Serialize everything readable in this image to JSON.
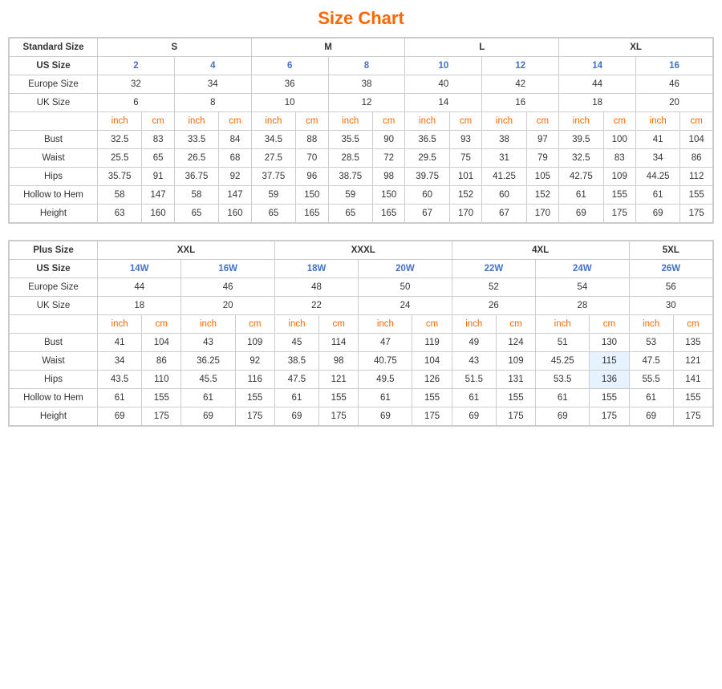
{
  "title": "Size Chart",
  "standard_table": {
    "main_header": "Standard Size",
    "size_groups": [
      "S",
      "M",
      "L",
      "XL"
    ],
    "us_sizes": [
      "2",
      "4",
      "6",
      "8",
      "10",
      "12",
      "14",
      "16"
    ],
    "europe_sizes": [
      "32",
      "34",
      "36",
      "38",
      "40",
      "42",
      "44",
      "46"
    ],
    "uk_sizes": [
      "6",
      "8",
      "10",
      "12",
      "14",
      "16",
      "18",
      "20"
    ],
    "inch_cm_header": [
      "inch",
      "cm",
      "inch",
      "cm",
      "inch",
      "cm",
      "inch",
      "cm",
      "inch",
      "cm",
      "inch",
      "cm",
      "inch",
      "cm",
      "inch",
      "cm"
    ],
    "bust": [
      "32.5",
      "83",
      "33.5",
      "84",
      "34.5",
      "88",
      "35.5",
      "90",
      "36.5",
      "93",
      "38",
      "97",
      "39.5",
      "100",
      "41",
      "104"
    ],
    "waist": [
      "25.5",
      "65",
      "26.5",
      "68",
      "27.5",
      "70",
      "28.5",
      "72",
      "29.5",
      "75",
      "31",
      "79",
      "32.5",
      "83",
      "34",
      "86"
    ],
    "hips": [
      "35.75",
      "91",
      "36.75",
      "92",
      "37.75",
      "96",
      "38.75",
      "98",
      "39.75",
      "101",
      "41.25",
      "105",
      "42.75",
      "109",
      "44.25",
      "112"
    ],
    "hollow_to_hem": [
      "58",
      "147",
      "58",
      "147",
      "59",
      "150",
      "59",
      "150",
      "60",
      "152",
      "60",
      "152",
      "61",
      "155",
      "61",
      "155"
    ],
    "height": [
      "63",
      "160",
      "65",
      "160",
      "65",
      "165",
      "65",
      "165",
      "67",
      "170",
      "67",
      "170",
      "69",
      "175",
      "69",
      "175"
    ]
  },
  "plus_table": {
    "main_header": "Plus Size",
    "size_groups": [
      "XXL",
      "XXXL",
      "4XL",
      "5XL"
    ],
    "us_sizes": [
      "14W",
      "16W",
      "18W",
      "20W",
      "22W",
      "24W",
      "26W"
    ],
    "europe_sizes": [
      "44",
      "46",
      "48",
      "50",
      "52",
      "54",
      "56"
    ],
    "uk_sizes": [
      "18",
      "20",
      "22",
      "24",
      "26",
      "28",
      "30"
    ],
    "inch_cm_header": [
      "inch",
      "cm",
      "inch",
      "cm",
      "inch",
      "cm",
      "inch",
      "cm",
      "inch",
      "cm",
      "inch",
      "cm",
      "inch",
      "cm"
    ],
    "bust": [
      "41",
      "104",
      "43",
      "109",
      "45",
      "114",
      "47",
      "119",
      "49",
      "124",
      "51",
      "130",
      "53",
      "135"
    ],
    "waist": [
      "34",
      "86",
      "36.25",
      "92",
      "38.5",
      "98",
      "40.75",
      "104",
      "43",
      "109",
      "45.25",
      "115",
      "47.5",
      "121"
    ],
    "hips": [
      "43.5",
      "110",
      "45.5",
      "116",
      "47.5",
      "121",
      "49.5",
      "126",
      "51.5",
      "131",
      "53.5",
      "136",
      "55.5",
      "141"
    ],
    "hollow_to_hem": [
      "61",
      "155",
      "61",
      "155",
      "61",
      "155",
      "61",
      "155",
      "61",
      "155",
      "61",
      "155",
      "61",
      "155"
    ],
    "height": [
      "69",
      "175",
      "69",
      "175",
      "69",
      "175",
      "69",
      "175",
      "69",
      "175",
      "69",
      "175",
      "69",
      "175"
    ]
  },
  "labels": {
    "us_size": "US Size",
    "europe_size": "Europe Size",
    "uk_size": "UK Size",
    "bust": "Bust",
    "waist": "Waist",
    "hips": "Hips",
    "hollow_to_hem": "Hollow to Hem",
    "height": "Height"
  }
}
